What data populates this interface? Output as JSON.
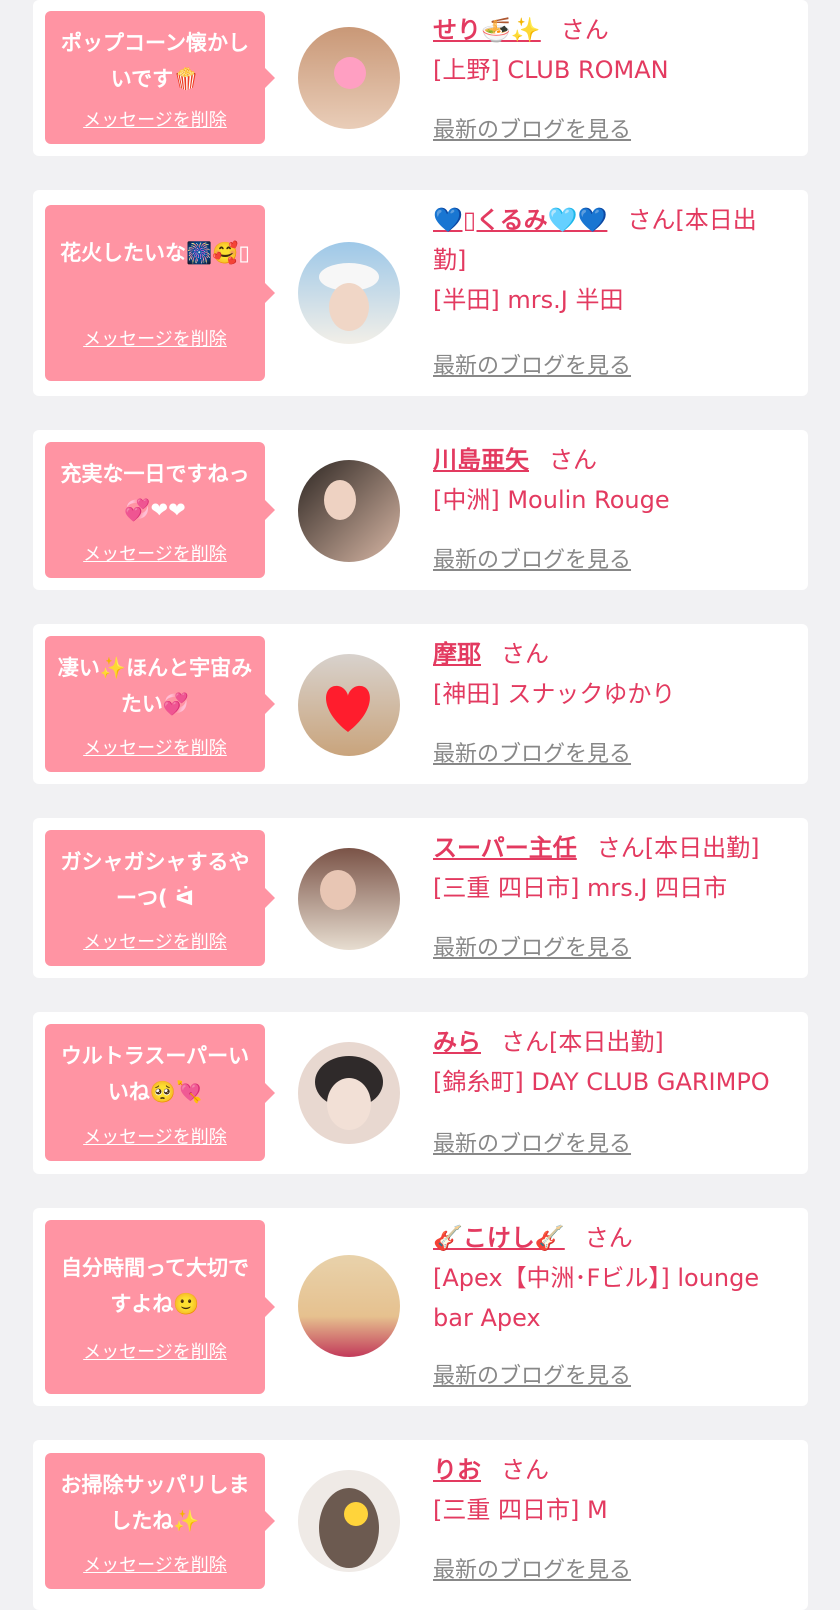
{
  "common": {
    "delete_label": "メッセージを削除",
    "blog_label": "最新のブログを見る",
    "san": "さん"
  },
  "entries": [
    {
      "message": "ポップコーン懐かしいです🍿",
      "name": "せり🍜✨",
      "suffix": "さん",
      "shop": "[上野] CLUB ROMAN",
      "avatar_colors": [
        "#c99877",
        "#e9cdb8"
      ]
    },
    {
      "message": "花火したいな🎆🥰▯",
      "name": "💙▯くるみ🩵💙",
      "suffix": "さん[本日出勤]",
      "shop": "[半田] mrs.J 半田",
      "avatar_colors": [
        "#9ec8e8",
        "#f2efe8"
      ]
    },
    {
      "message": "充実な一日ですねっ💞❤❤",
      "name": "川島亜矢",
      "suffix": "さん",
      "shop": "[中洲] Moulin Rouge",
      "avatar_colors": [
        "#2d2622",
        "#d8b7a5"
      ]
    },
    {
      "message": "凄い✨ほんと宇宙みたい💞",
      "name": "摩耶",
      "suffix": "さん",
      "shop": "[神田] スナックゆかり",
      "avatar_colors": [
        "#d8d2cd",
        "#c9a47c"
      ]
    },
    {
      "message": "ガシャガシャするやーつ( ᐛ",
      "name": "スーパー主任",
      "suffix": "さん[本日出勤]",
      "shop": "[三重 四日市] mrs.J 四日市",
      "avatar_colors": [
        "#7a5347",
        "#e7ddd0"
      ]
    },
    {
      "message": "ウルトラスーパーいいね🥺💘",
      "name": "みら",
      "suffix": "さん[本日出勤]",
      "shop": "[錦糸町] DAY CLUB GARIMPO",
      "avatar_colors": [
        "#2f2a2a",
        "#e8d8d0"
      ]
    },
    {
      "message": "自分時間って大切ですよね🙂",
      "name": "🎸こけし🎸",
      "suffix": "さん",
      "shop": "[Apex【中洲･Fビル】] lounge bar Apex",
      "avatar_colors": [
        "#e8d2ab",
        "#c23a5a"
      ]
    },
    {
      "message": "お掃除サッパリしましたね✨",
      "name": "りお",
      "suffix": "さん",
      "shop": "[三重 四日市] M",
      "avatar_colors": [
        "#cfc7c0",
        "#6c5a50"
      ]
    }
  ]
}
